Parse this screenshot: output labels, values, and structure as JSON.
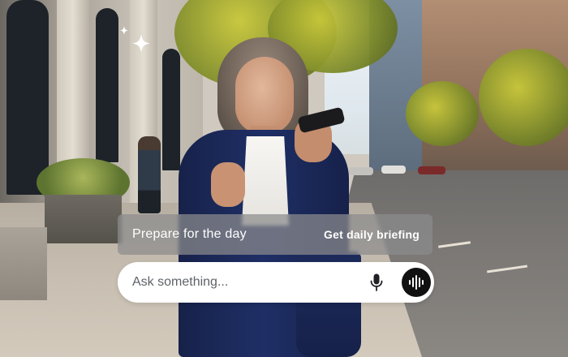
{
  "badge": {
    "icon": "sparkle-icon"
  },
  "suggestion": {
    "title": "Prepare for the day",
    "action_label": "Get daily briefing"
  },
  "search": {
    "placeholder": "Ask something...",
    "mic_icon": "microphone-icon",
    "voice_icon": "voice-waveform-icon"
  },
  "colors": {
    "suggestion_bg": "#8c8c8e",
    "ask_bar_bg": "#ffffff",
    "voice_button_bg": "#111111",
    "text_light": "#ffffff",
    "placeholder_text": "#5f6368"
  }
}
